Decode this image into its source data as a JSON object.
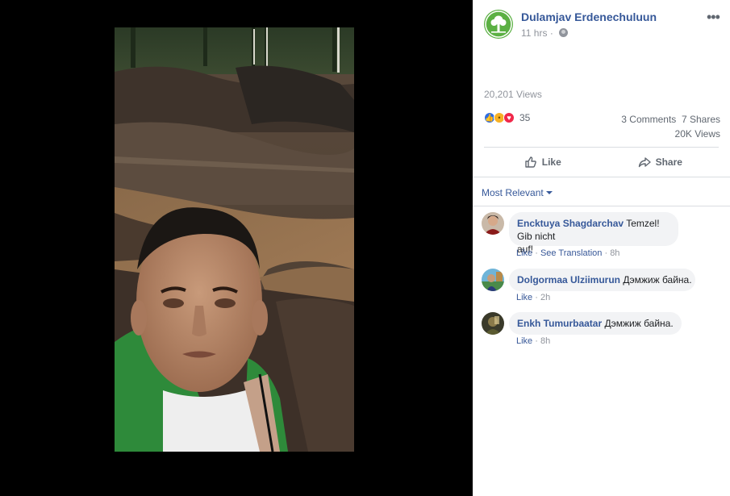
{
  "post": {
    "author": "Dulamjav Erdenechuluun",
    "time": "11 hrs",
    "views_line": "20,201 Views",
    "reaction_count": "35",
    "comments": "3 Comments",
    "shares": "7 Shares",
    "views_short": "20K Views"
  },
  "icons": {
    "logo": "tree-logo-icon",
    "privacy": "globe-icon",
    "more": "more-options-icon",
    "like": "thumbs-up-icon",
    "share": "share-arrow-icon"
  },
  "actions": {
    "like_label": "Like",
    "share_label": "Share"
  },
  "sort_label": "Most Relevant",
  "comments": [
    {
      "name": "Encktuya Shagdarchav",
      "text_line1": "Temzel! Gib nicht",
      "text_line2": "auf!",
      "like": "Like",
      "translate": "See Translation",
      "time": "8h"
    },
    {
      "name": "Dolgormaa Ulziimurun",
      "text": "Дэмжиж байна.",
      "like": "Like",
      "time": "2h"
    },
    {
      "name": "Enkh Tumurbaatar",
      "text": "Дэмжиж байна.",
      "like": "Like",
      "time": "8h"
    }
  ],
  "colors": {
    "link": "#365899",
    "logo_green": "#5bb043",
    "muted": "#90949c"
  }
}
